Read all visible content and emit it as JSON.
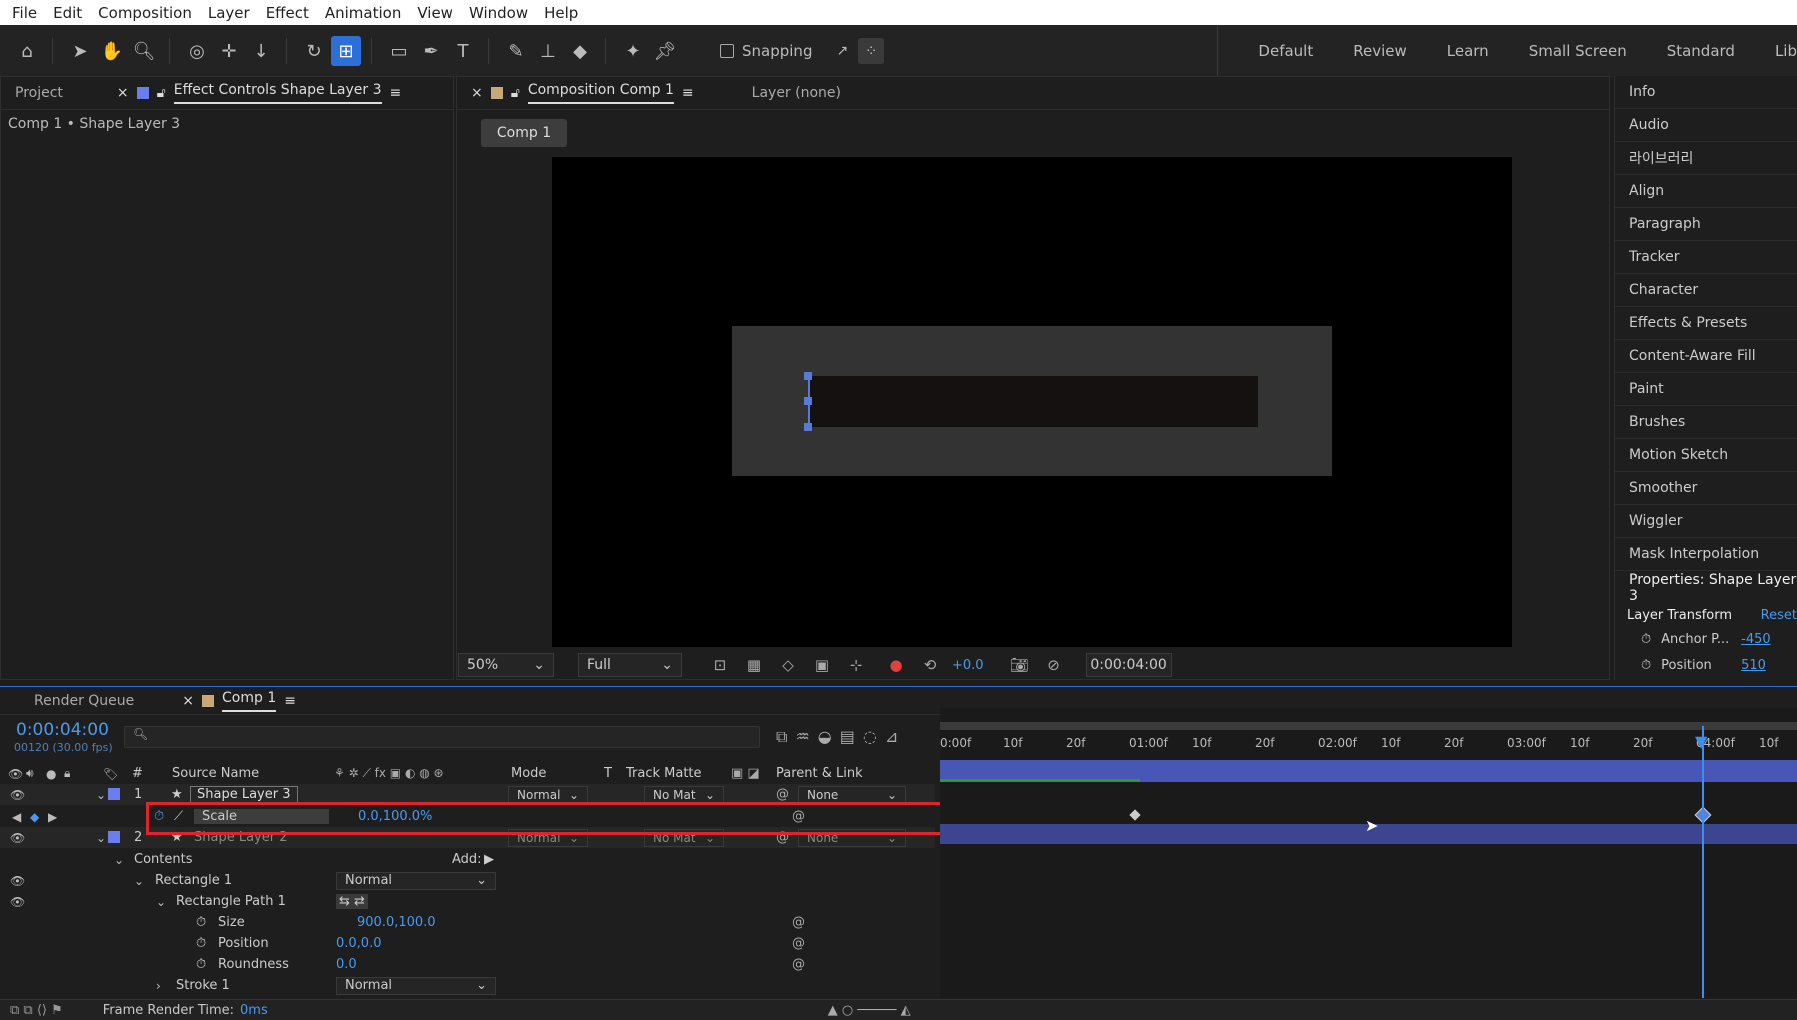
{
  "menubar": [
    "File",
    "Edit",
    "Composition",
    "Layer",
    "Effect",
    "Animation",
    "View",
    "Window",
    "Help"
  ],
  "toolbar": {
    "snapping_label": "Snapping",
    "workspaces": [
      "Default",
      "Review",
      "Learn",
      "Small Screen",
      "Standard",
      "Lib"
    ]
  },
  "left_panel": {
    "tab_project": "Project",
    "tab_effect_controls": "Effect Controls Shape Layer 3",
    "breadcrumb": "Comp 1 • Shape Layer 3"
  },
  "comp_panel": {
    "tab_composition": "Composition Comp 1",
    "tab_layer": "Layer (none)",
    "comp_button": "Comp 1",
    "zoom": "50%",
    "resolution": "Full",
    "exposure": "+0.0",
    "timecode": "0:00:04:00"
  },
  "right_panel": {
    "items": [
      "Info",
      "Audio",
      "라이브러리",
      "Align",
      "Paragraph",
      "Tracker",
      "Character",
      "Effects & Presets",
      "Content-Aware Fill",
      "Paint",
      "Brushes",
      "Motion Sketch",
      "Smoother",
      "Wiggler",
      "Mask Interpolation"
    ],
    "properties_title": "Properties: Shape Layer 3",
    "layer_transform": "Layer Transform",
    "reset": "Reset",
    "anchor_label": "Anchor P...",
    "anchor_value": "-450",
    "position_label": "Position",
    "position_value": "510"
  },
  "timeline": {
    "tab_render_queue": "Render Queue",
    "tab_comp": "Comp 1",
    "current_time": "0:00:04:00",
    "frame_info": "00120 (30.00 fps)",
    "search_placeholder": "",
    "headers": {
      "number": "#",
      "source_name": "Source Name",
      "mode": "Mode",
      "t": "T",
      "track_matte": "Track Matte",
      "parent_link": "Parent & Link"
    },
    "ruler": [
      "0:00f",
      "10f",
      "20f",
      "01:00f",
      "10f",
      "20f",
      "02:00f",
      "10f",
      "20f",
      "03:00f",
      "10f",
      "20f",
      "04:00f",
      "10f"
    ],
    "layer1": {
      "num": "1",
      "name": "Shape Layer 3",
      "mode": "Normal",
      "matte": "No Mat",
      "parent": "None"
    },
    "scale": {
      "label": "Scale",
      "value": "0.0,100.0%"
    },
    "layer2": {
      "num": "2",
      "name": "Shape Layer 2",
      "mode": "Normal",
      "matte": "No Mat",
      "parent": "None"
    },
    "contents": "Contents",
    "add": "Add:",
    "rectangle1": "Rectangle 1",
    "rect1_mode": "Normal",
    "rectangle_path": "Rectangle Path 1",
    "size": {
      "label": "Size",
      "value": "900.0,100.0"
    },
    "position": {
      "label": "Position",
      "value": "0.0,0.0"
    },
    "roundness": {
      "label": "Roundness",
      "value": "0.0"
    },
    "stroke": "Stroke 1",
    "stroke_mode": "Normal",
    "frame_render_label": "Frame Render Time:",
    "frame_render_value": "0ms"
  },
  "colors": {
    "accent": "#2d6fd9",
    "highlight_box": "#e0242b",
    "layer_bar": "#4856b5",
    "label_blue": "#7080e0"
  }
}
